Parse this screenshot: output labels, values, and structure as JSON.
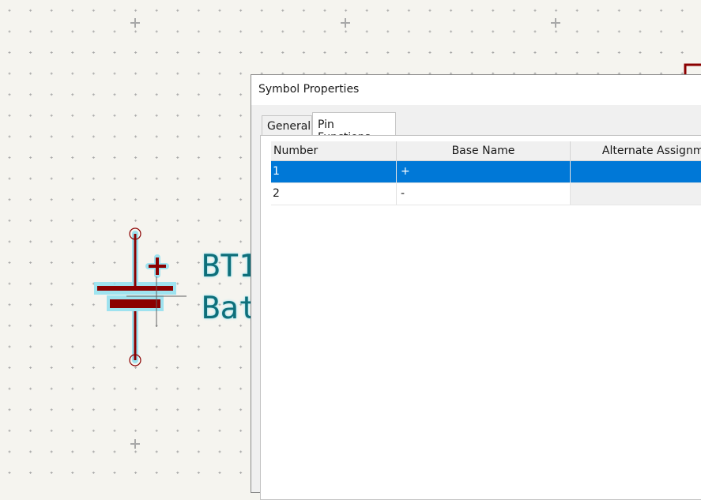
{
  "dialog": {
    "title": "Symbol Properties",
    "tabs": [
      {
        "label": "General",
        "active": false
      },
      {
        "label": "Pin Functions",
        "active": true
      }
    ]
  },
  "pin_grid": {
    "columns": [
      "Number",
      "Base Name",
      "Alternate Assignme"
    ],
    "rows": [
      {
        "number": "1",
        "base_name": "+",
        "alternate": "",
        "selected": true
      },
      {
        "number": "2",
        "base_name": "-",
        "alternate": "",
        "selected": false
      }
    ]
  },
  "schematic": {
    "reference": "BT1",
    "value_partial": "Bat",
    "polarity_mark": "+"
  },
  "colors": {
    "symbol": "#8b0000",
    "label": "#0e6f7a",
    "highlight": "#8fe0ef",
    "selection": "#0078d7",
    "canvas": "#f5f4ef"
  }
}
